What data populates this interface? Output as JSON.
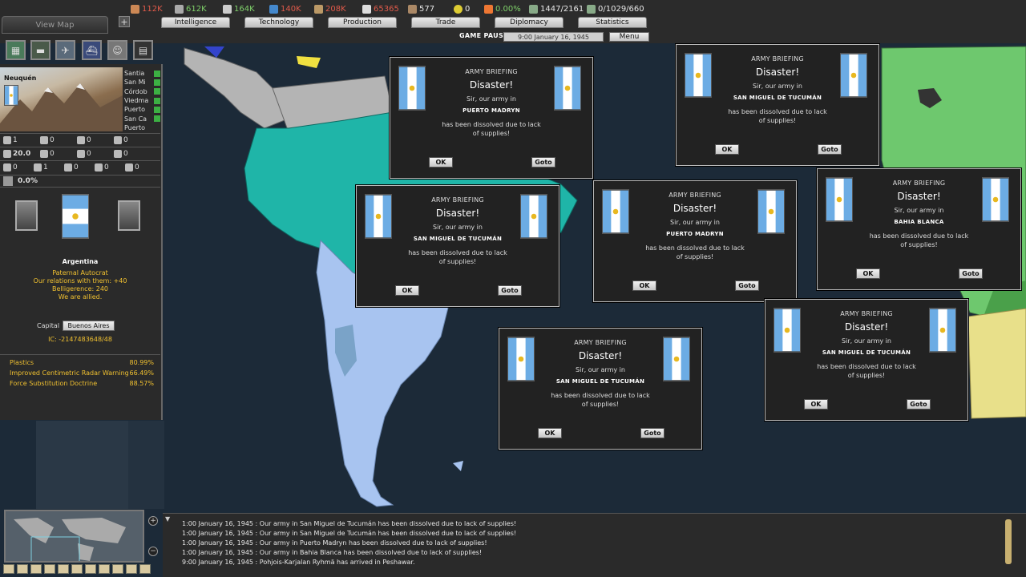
{
  "resources": [
    {
      "icon": "energy-icon",
      "value": "112K",
      "color": "#e05a4a"
    },
    {
      "icon": "metal-icon",
      "value": "612K",
      "color": "#7fd06a"
    },
    {
      "icon": "rare-materials-icon",
      "value": "164K",
      "color": "#7fd06a"
    },
    {
      "icon": "oil-icon",
      "value": "140K",
      "color": "#e05a4a"
    },
    {
      "icon": "supplies-icon",
      "value": "208K",
      "color": "#e05a4a"
    },
    {
      "icon": "money-icon",
      "value": "65365",
      "color": "#e05a4a"
    },
    {
      "icon": "manpower-icon",
      "value": "577",
      "color": "#e8e8e8"
    },
    {
      "icon": "nuclear-icon",
      "value": "0",
      "color": "#e8e8e8"
    },
    {
      "icon": "dissent-icon",
      "value": "0.00%",
      "color": "#7fd06a"
    },
    {
      "icon": "transport-icon",
      "value": "1447/2161",
      "color": "#e8e8e8"
    },
    {
      "icon": "escort-icon",
      "value": "0/1029/660",
      "color": "#e8e8e8"
    }
  ],
  "tabs": {
    "view_map": "View Map",
    "intelligence": "Intelligence",
    "technology": "Technology",
    "production": "Production",
    "trade": "Trade",
    "diplomacy": "Diplomacy",
    "statistics": "Statistics"
  },
  "game_status": "GAME PAUSED",
  "game_date": "9:00 January 16, 1945",
  "menu_label": "Menu",
  "province": {
    "name": "Neuquén",
    "cities": [
      "Santia",
      "San Mi",
      "Córdob",
      "Viedma",
      "Puerto",
      "San Ca",
      "Puerto"
    ]
  },
  "stats_row1": [
    {
      "icon": "factory-icon",
      "value": "1"
    },
    {
      "icon": "infrastructure-icon",
      "value": "0"
    },
    {
      "icon": "airbase-icon",
      "value": "0"
    },
    {
      "icon": "aa-icon",
      "value": "0"
    }
  ],
  "stats_row2": [
    {
      "icon": "supply-icon",
      "value": "20.0"
    },
    {
      "icon": "naval-base-icon",
      "value": "0"
    },
    {
      "icon": "radar-icon",
      "value": "0"
    },
    {
      "icon": "nuclear-reactor-icon",
      "value": "0"
    }
  ],
  "stats_row3": [
    {
      "icon": "energy-small-icon",
      "value": "0"
    },
    {
      "icon": "metal-small-icon",
      "value": "1"
    },
    {
      "icon": "oil-small-icon",
      "value": "0"
    },
    {
      "icon": "rare-small-icon",
      "value": "0"
    },
    {
      "icon": "supplies-small-icon",
      "value": "0"
    }
  ],
  "dissent_value": "0.0%",
  "country": {
    "name": "Argentina",
    "government": "Paternal Autocrat",
    "relations": "Our relations with them: +40",
    "belligerence": "Belligerence: 240",
    "alliance": "We are allied.",
    "capital_label": "Capital",
    "capital_value": "Buenos Aires",
    "ic": "IC: -2147483648/48"
  },
  "techs": [
    {
      "name": "Plastics",
      "value": "80.99%"
    },
    {
      "name": "Improved Centimetric Radar Warning",
      "value": "66.49%"
    },
    {
      "name": "Force Substitution Doctrine",
      "value": "88.57%"
    }
  ],
  "dialogs": [
    {
      "header": "ARMY BRIEFING",
      "title": "Disaster!",
      "line1": "Sir, our army in",
      "place": "PUERTO MADRYN",
      "line2": "has been dissolved due to lack",
      "line3": "of supplies!",
      "ok": "OK",
      "goto": "Goto"
    },
    {
      "header": "ARMY BRIEFING",
      "title": "Disaster!",
      "line1": "Sir, our army in",
      "place": "SAN MIGUEL DE TUCUMÁN",
      "line2": "has been dissolved due to lack",
      "line3": "of supplies!",
      "ok": "OK",
      "goto": "Goto"
    },
    {
      "header": "ARMY BRIEFING",
      "title": "Disaster!",
      "line1": "Sir, our army in",
      "place": "SAN MIGUEL DE TUCUMÁN",
      "line2": "has been dissolved due to lack",
      "line3": "of supplies!",
      "ok": "OK",
      "goto": "Goto"
    },
    {
      "header": "ARMY BRIEFING",
      "title": "Disaster!",
      "line1": "Sir, our army in",
      "place": "PUERTO MADRYN",
      "line2": "has been dissolved due to lack",
      "line3": "of supplies!",
      "ok": "OK",
      "goto": "Goto"
    },
    {
      "header": "ARMY BRIEFING",
      "title": "Disaster!",
      "line1": "Sir, our army in",
      "place": "BAHIA BLANCA",
      "line2": "has been dissolved due to lack",
      "line3": "of supplies!",
      "ok": "OK",
      "goto": "Goto"
    },
    {
      "header": "ARMY BRIEFING",
      "title": "Disaster!",
      "line1": "Sir, our army in",
      "place": "SAN MIGUEL DE TUCUMÁN",
      "line2": "has been dissolved due to lack",
      "line3": "of supplies!",
      "ok": "OK",
      "goto": "Goto"
    },
    {
      "header": "ARMY BRIEFING",
      "title": "Disaster!",
      "line1": "Sir, our army in",
      "place": "SAN MIGUEL DE TUCUMÁN",
      "line2": "has been dissolved due to lack",
      "line3": "of supplies!",
      "ok": "OK",
      "goto": "Goto"
    }
  ],
  "log": [
    "1:00 January 16, 1945 : Our army in San Miguel de Tucumán has been dissolved due to lack of supplies!",
    "1:00 January 16, 1945 : Our army in San Miguel de Tucumán has been dissolved due to lack of supplies!",
    "1:00 January 16, 1945 : Our army in Puerto Madryn has been dissolved due to lack of supplies!",
    "1:00 January 16, 1945 : Our army in Bahia Blanca has been dissolved due to lack of supplies!",
    "9:00 January 16, 1945 : Pohjois-Karjalan Ryhmä has arrived in Peshawar."
  ],
  "colors": {
    "argentina": "#a8c4f0",
    "ally_teal": "#1fb5a8",
    "neutral_gray": "#b4b4b4",
    "ocean": "#1c2a38",
    "green_nation": "#6ec86e",
    "yellow_nation": "#e8e08a"
  }
}
